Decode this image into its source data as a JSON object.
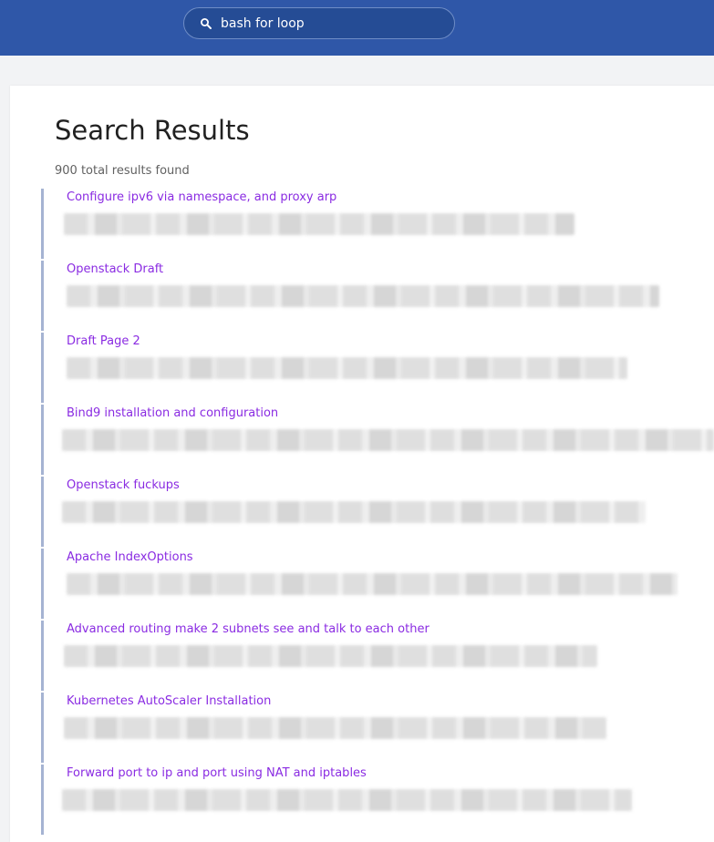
{
  "search": {
    "value": "bash for loop",
    "icon": "search-icon"
  },
  "page": {
    "title": "Search Results",
    "count": "900 total results found"
  },
  "results": [
    {
      "title": "Configure ipv6 via namespace, and proxy arp"
    },
    {
      "title": "Openstack Draft"
    },
    {
      "title": "Draft Page 2"
    },
    {
      "title": "Bind9 installation and configuration"
    },
    {
      "title": "Openstack fuckups"
    },
    {
      "title": "Apache IndexOptions"
    },
    {
      "title": "Advanced routing make 2 subnets see and talk to each other"
    },
    {
      "title": "Kubernetes AutoScaler Installation"
    },
    {
      "title": "Forward port to ip and port using NAT and iptables"
    }
  ],
  "colors": {
    "header": "#2f57a8",
    "link": "#8a2be2",
    "result_border": "#a5b3d2"
  }
}
